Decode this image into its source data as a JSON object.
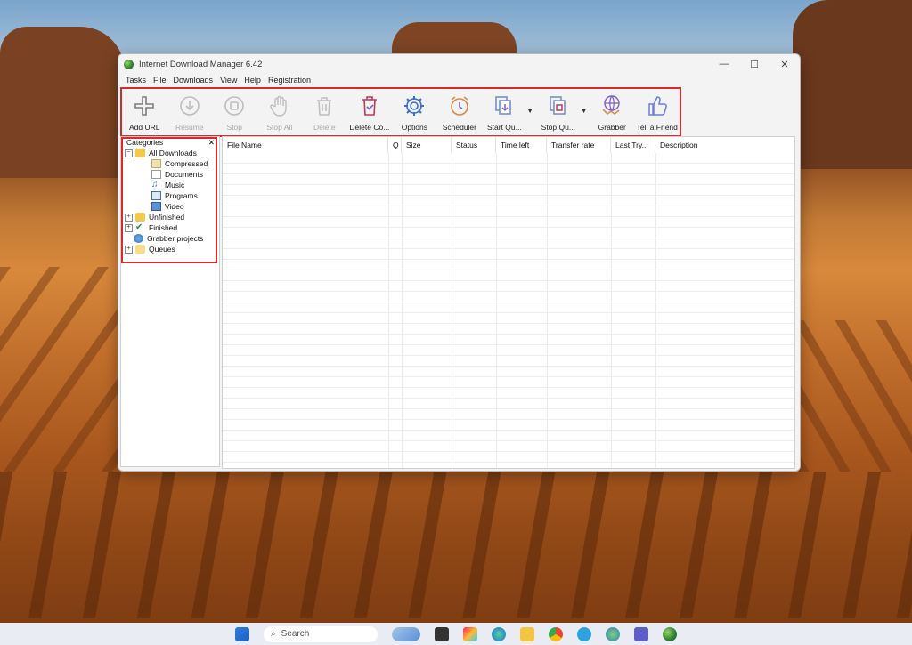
{
  "window": {
    "title": "Internet Download Manager 6.42"
  },
  "menu": [
    "Tasks",
    "File",
    "Downloads",
    "View",
    "Help",
    "Registration"
  ],
  "toolbar": {
    "buttons": [
      {
        "label": "Add URL",
        "icon": "add-url-icon",
        "enabled": true
      },
      {
        "label": "Resume",
        "icon": "resume-icon",
        "enabled": false
      },
      {
        "label": "Stop",
        "icon": "stop-icon",
        "enabled": false
      },
      {
        "label": "Stop All",
        "icon": "stop-all-icon",
        "enabled": false
      },
      {
        "label": "Delete",
        "icon": "delete-icon",
        "enabled": false
      },
      {
        "label": "Delete Co...",
        "icon": "delete-completed-icon",
        "enabled": true
      },
      {
        "label": "Options",
        "icon": "options-gear-icon",
        "enabled": true
      },
      {
        "label": "Scheduler",
        "icon": "scheduler-clock-icon",
        "enabled": true
      },
      {
        "label": "Start Qu...",
        "icon": "start-queue-icon",
        "enabled": true
      },
      {
        "label": "Stop Qu...",
        "icon": "stop-queue-icon",
        "enabled": true
      },
      {
        "label": "Grabber",
        "icon": "grabber-icon",
        "enabled": true
      },
      {
        "label": "Tell a Friend",
        "icon": "thumbs-up-icon",
        "enabled": true
      }
    ]
  },
  "categories": {
    "header": "Categories",
    "close": "✕",
    "items": [
      {
        "label": "All Downloads",
        "level": 0,
        "expanded": true
      },
      {
        "label": "Compressed",
        "level": 1
      },
      {
        "label": "Documents",
        "level": 1
      },
      {
        "label": "Music",
        "level": 1
      },
      {
        "label": "Programs",
        "level": 1
      },
      {
        "label": "Video",
        "level": 1
      },
      {
        "label": "Unfinished",
        "level": 0,
        "collapsed": true
      },
      {
        "label": "Finished",
        "level": 0,
        "collapsed": true
      },
      {
        "label": "Grabber projects",
        "level": 0
      },
      {
        "label": "Queues",
        "level": 0,
        "collapsed": true
      }
    ]
  },
  "columns": [
    "File Name",
    "Q",
    "Size",
    "Status",
    "Time left",
    "Transfer rate",
    "Last Try...",
    "Description"
  ],
  "taskbar": {
    "search_placeholder": "Search"
  },
  "colors": {
    "highlight": "#d62b2b",
    "window_bg": "#f3f3f3",
    "icon_purple": "#7b5fc7"
  }
}
